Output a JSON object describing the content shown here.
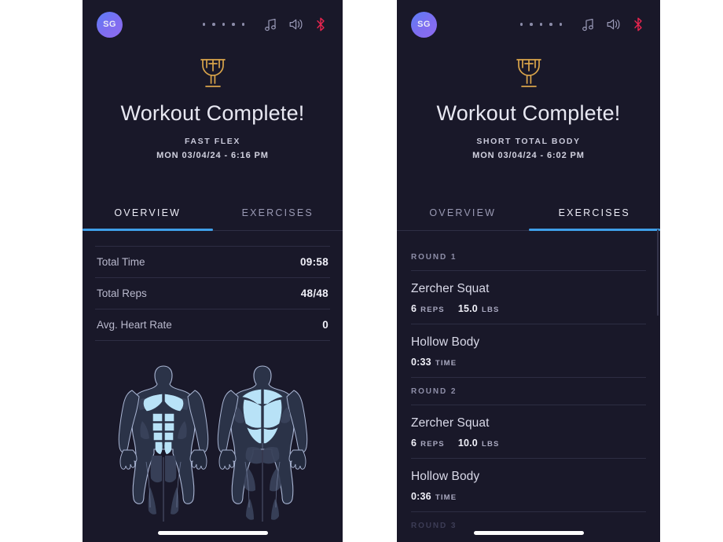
{
  "screens": [
    {
      "id": "left",
      "status_bar": {
        "avatar_initials": "SG",
        "dot_count": 5,
        "icons": [
          "music-note-icon",
          "speaker-icon",
          "bluetooth-icon"
        ],
        "bluetooth_color": "#e8254f",
        "icon_color": "#8b8ba8"
      },
      "hero": {
        "trophy_icon": "trophy-icon",
        "trophy_color": "#d9a44a",
        "title": "Workout Complete!",
        "subtitle": "FAST FLEX",
        "datetime": "MON 03/04/24 - 6:16 PM"
      },
      "tabs": {
        "items": [
          {
            "label": "OVERVIEW",
            "active": true
          },
          {
            "label": "EXERCISES",
            "active": false
          }
        ],
        "accent": "#3f9fe8"
      },
      "overview": {
        "stats": [
          {
            "label": "Total Time",
            "value": "09:58"
          },
          {
            "label": "Total Reps",
            "value": "48/48"
          },
          {
            "label": "Avg. Heart Rate",
            "value": "0"
          }
        ],
        "body_diagram": {
          "front_label": "body-front-anatomy",
          "back_label": "body-back-anatomy",
          "highlight_color": "#b8e2f7",
          "muscle_color": "#3a4358",
          "outline_color": "#aab6d4",
          "front_highlighted": [
            "chest",
            "abs"
          ],
          "back_highlighted": [
            "traps",
            "lats"
          ]
        }
      }
    },
    {
      "id": "right",
      "status_bar": {
        "avatar_initials": "SG",
        "dot_count": 5,
        "icons": [
          "music-note-icon",
          "speaker-icon",
          "bluetooth-icon"
        ],
        "bluetooth_color": "#e8254f",
        "icon_color": "#8b8ba8"
      },
      "hero": {
        "trophy_icon": "trophy-icon",
        "trophy_color": "#d9a44a",
        "title": "Workout Complete!",
        "subtitle": "SHORT TOTAL BODY",
        "datetime": "MON 03/04/24 - 6:02 PM"
      },
      "tabs": {
        "items": [
          {
            "label": "OVERVIEW",
            "active": false
          },
          {
            "label": "EXERCISES",
            "active": true
          }
        ],
        "accent": "#3f9fe8"
      },
      "exercises": {
        "rounds": [
          {
            "header": "ROUND 1",
            "items": [
              {
                "name": "Zercher Squat",
                "metrics": [
                  {
                    "value": "6",
                    "unit": "REPS"
                  },
                  {
                    "value": "15.0",
                    "unit": "LBS"
                  }
                ]
              },
              {
                "name": "Hollow Body",
                "metrics": [
                  {
                    "value": "0:33",
                    "unit": "TIME"
                  }
                ]
              }
            ]
          },
          {
            "header": "ROUND 2",
            "items": [
              {
                "name": "Zercher Squat",
                "metrics": [
                  {
                    "value": "6",
                    "unit": "REPS"
                  },
                  {
                    "value": "10.0",
                    "unit": "LBS"
                  }
                ]
              },
              {
                "name": "Hollow Body",
                "metrics": [
                  {
                    "value": "0:36",
                    "unit": "TIME"
                  }
                ]
              }
            ]
          },
          {
            "header": "ROUND 3",
            "partial": true,
            "items": []
          }
        ]
      }
    }
  ],
  "theme": {
    "background": "#191829",
    "page_background": "#ffffff",
    "divider": "#2d2d43",
    "text_primary": "#e8e8f2",
    "text_secondary": "#b9b9cd",
    "accent_blue": "#3f9fe8",
    "gold": "#d9a44a"
  }
}
